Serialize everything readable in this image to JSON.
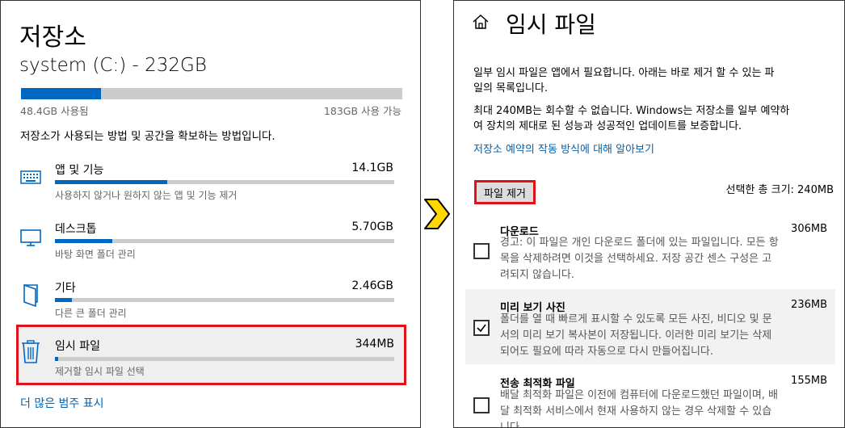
{
  "left": {
    "title": "저장소",
    "drive": "system (C:) - 232GB",
    "usage_fraction": 0.21,
    "used_label": "48.4GB 사용됨",
    "avail_label": "183GB 사용 가능",
    "description": "저장소가 사용되는 방법 및 공간을 확보하는 방법입니다.",
    "categories": [
      {
        "name": "앱 및 기능",
        "size": "14.1GB",
        "sub": "사용하지 않거나 원하지 않는 앱 및 기능 제거",
        "icon": "keyboard-icon",
        "fraction": 0.33
      },
      {
        "name": "데스크톱",
        "size": "5.70GB",
        "sub": "바탕 화면 폴더 관리",
        "icon": "monitor-icon",
        "fraction": 0.17
      },
      {
        "name": "기타",
        "size": "2.46GB",
        "sub": "다른 큰 폴더 관리",
        "icon": "folder-icon",
        "fraction": 0.05
      },
      {
        "name": "임시 파일",
        "size": "344MB",
        "sub": "제거할 임시 파일 선택",
        "icon": "trash-icon",
        "fraction": 0.01
      }
    ],
    "more_link": "더 많은 범주 표시"
  },
  "right": {
    "title": "임시 파일",
    "para1_line1": "일부 임시 파일은 앱에서 필요합니다. 아래는 바로 제거 할 수 있는 파",
    "para1_line2": "일의 목록입니다.",
    "para2_line1": "최대 240MB는 회수할 수 없습니다. Windows는 저장소를 일부 예약하",
    "para2_line2": "여 장치의 제대로 된 성능과 성공적인 업데이트를 보증합니다.",
    "link": "저장소 예약의 작동 방식에 대해 알아보기",
    "remove_button": "파일 제거",
    "selected_total": "선택한 총 크기: 240MB",
    "files": [
      {
        "name": "다운로드",
        "size": "306MB",
        "checked": false,
        "desc": [
          "경고: 이 파일은 개인 다운로드 폴더에 있는 파일입니다. 모든 항",
          "목을 삭제하려면 이것을 선택하세요. 저장 공간 센스 구성은 고",
          "려되지 않습니다."
        ]
      },
      {
        "name": "미리 보기 사진",
        "size": "236MB",
        "checked": true,
        "desc": [
          "폴더를 열 때 빠르게 표시할 수 있도록 모든 사진, 비디오 및 문",
          "서의 미리 보기 복사본이 저장됩니다. 이러한 미리 보기는 삭제",
          "되어도 필요에 따라 자동으로 다시 만들어집니다."
        ]
      },
      {
        "name": "전송 최적화 파일",
        "size": "155MB",
        "checked": false,
        "desc": [
          "배달 최적화 파일은 이전에 컴퓨터에 다운로드했던 파일이며, 배",
          "달 최적화 서비스에서 현재 사용하지 않는 경우 삭제할 수 있습",
          "니다."
        ]
      }
    ]
  },
  "colors": {
    "accent": "#0067c0",
    "highlight": "#e0111b",
    "arrow": "#ffd800"
  }
}
